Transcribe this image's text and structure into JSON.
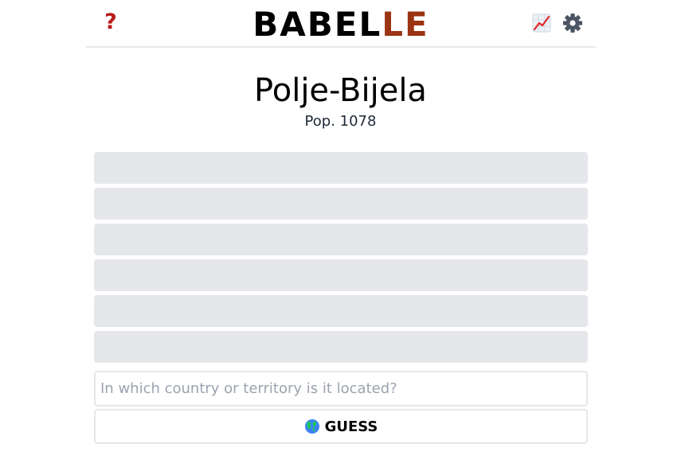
{
  "header": {
    "help_icon": "question-mark-icon",
    "help_glyph": "?",
    "logo_part_a": "BABEL",
    "logo_part_b": "LE",
    "stats_icon": "chart-increasing-icon",
    "settings_icon": "gear-icon"
  },
  "city": {
    "name": "Polje-Bijela",
    "population": "Pop. 1078"
  },
  "guess_rows": [
    {
      "value": ""
    },
    {
      "value": ""
    },
    {
      "value": ""
    },
    {
      "value": ""
    },
    {
      "value": ""
    },
    {
      "value": ""
    }
  ],
  "input": {
    "value": "",
    "placeholder": "In which country or territory is it located?"
  },
  "guess_button": {
    "icon": "globe-icon",
    "label": "GUESS"
  },
  "colors": {
    "help": "#b91c1c",
    "logo_accent": "#9a3412",
    "row_bg": "#e5e7eb",
    "border": "#e5e7eb",
    "gear": "#4b5563",
    "placeholder": "#9ca3af"
  }
}
